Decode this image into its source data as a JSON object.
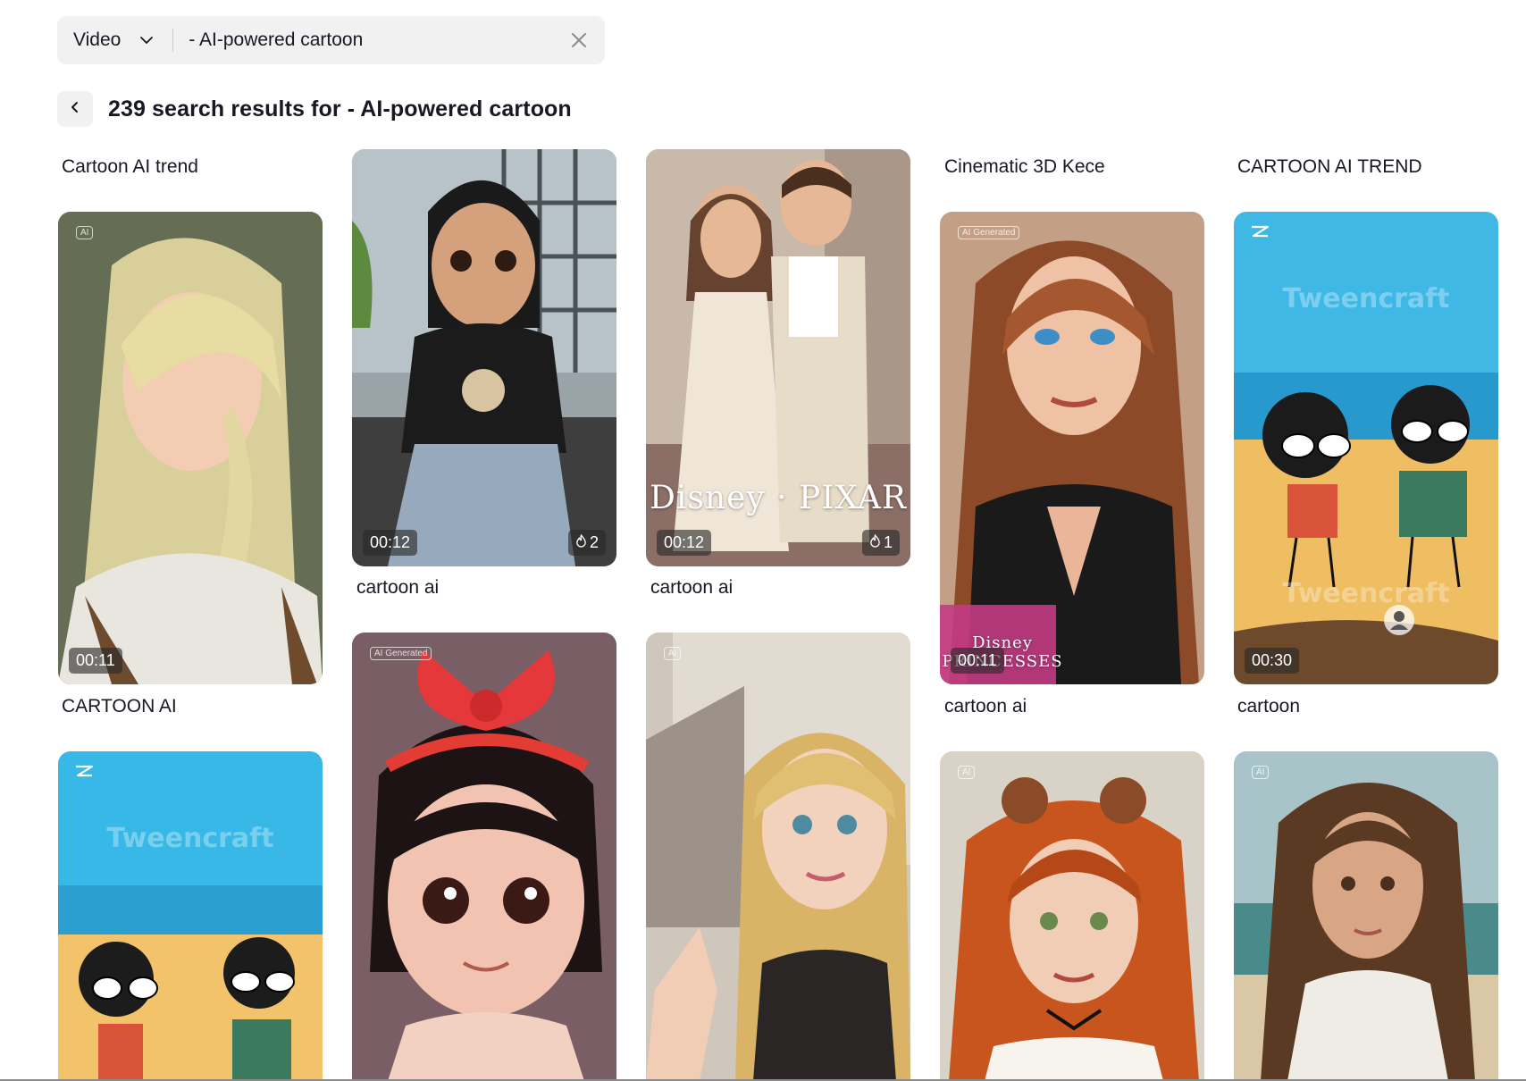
{
  "search": {
    "type_label": "Video",
    "query": "- AI-powered cartoon"
  },
  "results": {
    "title": "239 search results for - AI-powered cartoon"
  },
  "colors": {
    "text": "#161823",
    "field_bg": "#f1f1f2",
    "badge_bg": "rgba(40,40,40,0.62)"
  },
  "cards": [
    {
      "title": "Cartoon AI trend",
      "duration": "00:11",
      "icon": "ai-generated-tag"
    },
    {
      "title": "cartoon ai",
      "duration": "00:12",
      "likes": "2",
      "icon": "flame-icon"
    },
    {
      "title": "cartoon ai",
      "duration": "00:12",
      "likes": "1",
      "overlay": "Disney · PIXAR",
      "icon": "flame-icon"
    },
    {
      "title": "Cinematic 3D Kece",
      "duration": "00:11",
      "overlay": "Disney PRINCESSES",
      "icon": "ai-generated-tag"
    },
    {
      "title": "CARTOON AI TREND",
      "duration": "00:30",
      "watermark": "Tweencraft",
      "icon": "capcut-icon"
    },
    {
      "title": "CARTOON AI",
      "watermark": "Tweencraft",
      "icon": "capcut-icon"
    },
    {
      "title": "",
      "icon": "ai-generated-tag"
    },
    {
      "title": "",
      "icon": "ai-generated-tag"
    },
    {
      "title": "cartoon ai",
      "icon": "ai-generated-tag"
    },
    {
      "title": "cartoon",
      "icon": "ai-generated-tag"
    }
  ]
}
